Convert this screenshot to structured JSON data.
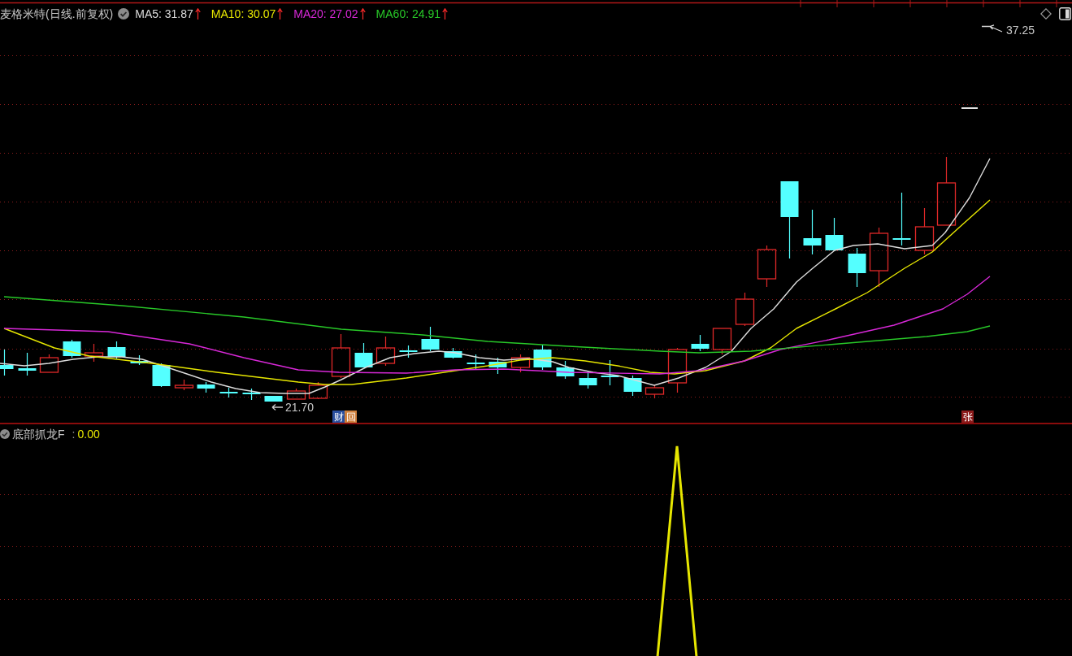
{
  "main_pane": {
    "title": "麦格米特(日线.前复权)",
    "ma_legend": [
      {
        "label": "MA5: 31.87",
        "color": "#dcdcdc",
        "rising": true
      },
      {
        "label": "MA10: 30.07",
        "color": "#e6e600",
        "rising": true
      },
      {
        "label": "MA20: 27.02",
        "color": "#d828d8",
        "rising": true
      },
      {
        "label": "MA60: 24.91",
        "color": "#28c828",
        "rising": true
      }
    ],
    "high_label": "37.25",
    "low_label": "21.70",
    "event_markers": [
      {
        "text": "财",
        "color": "#2a4f9e"
      },
      {
        "text": "回",
        "color": "#d0803c"
      },
      {
        "text": "张",
        "color": "#8c1c1c"
      }
    ]
  },
  "indicator_pane": {
    "label": "底部抓龙F",
    "separator": ":",
    "value": "0.00"
  }
}
